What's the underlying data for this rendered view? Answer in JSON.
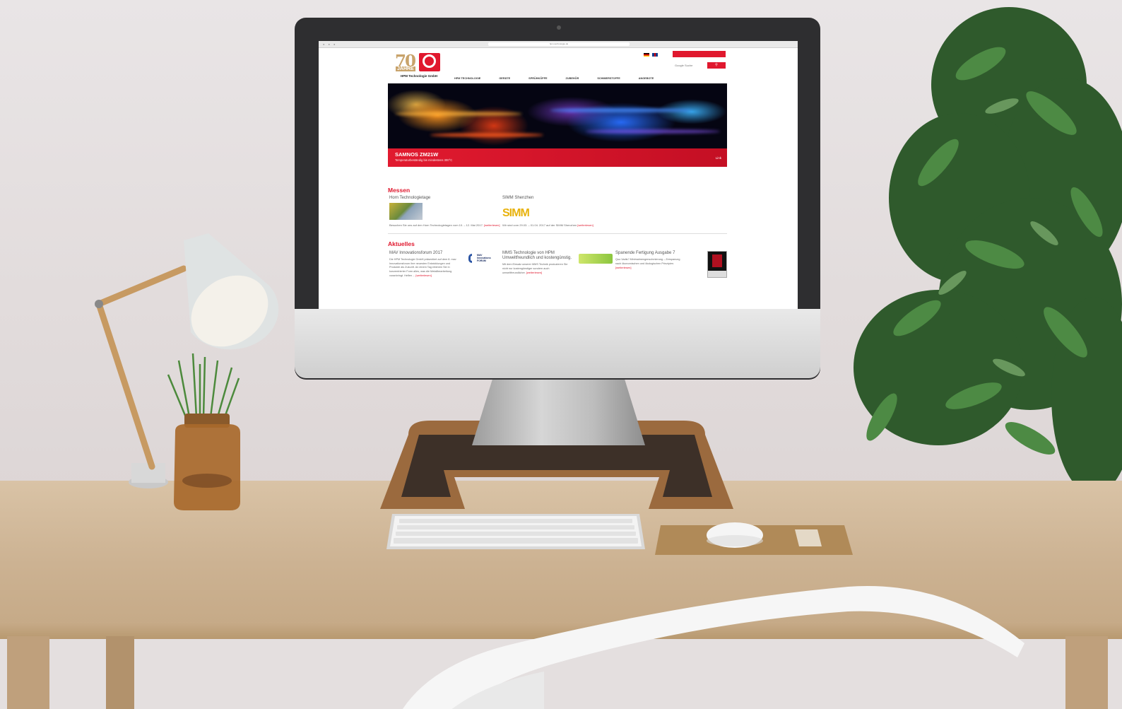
{
  "browser": {
    "url": "hpm-technologie.de"
  },
  "site": {
    "logo": {
      "number": "70",
      "jahre": "JAHRE",
      "company": "HPM Technologie GmbH"
    },
    "search": {
      "placeholder": "Google Suche",
      "button_icon": "search-icon"
    },
    "nav": [
      "HPM TECHNOLOGIE",
      "GERÄTE",
      "SPRÜHKÖPFE",
      "ZUBEHÖR",
      "SCHMIERSTOFFE",
      "ANGEBOTE"
    ],
    "hero": {
      "title": "SAMNOS ZM21W",
      "subtitle": "Temperaturbeständig bis mindestens 300°C",
      "link": "Link"
    },
    "messen": {
      "heading": "Messen",
      "items": [
        {
          "title": "Horn Technologietage",
          "text": "Besuchen Sie uns auf den Horn Technologietagen vom 10. – 12. Mai 2017.",
          "more": "[weiterlesen]"
        },
        {
          "title": "SIMM Shenzhen",
          "thumb_label": "SIMM",
          "text": "Wir sind vom 29.03. – 01.04. 2017 auf der SIMM Shenzhen",
          "more": "[weiterlesen]"
        }
      ]
    },
    "aktuelles": {
      "heading": "Aktuelles",
      "items": [
        {
          "title": "MAV Innovationsforum 2017",
          "thumb_label": "MAV Innovations FORUM",
          "text": "Die HPM Technologie GmbH präsentiert auf dem 8. mav Innovationsforum ihre neuesten Entwicklungen und Produkte als Zukunft. An einem Tag erfahren Sie in konzentrierter Form alles, was die Metallbearbeitung voranbringt. Helfen ...",
          "more": "[weiterlesen]"
        },
        {
          "title": "MMS Technologie von HPM Umweltfreundlich und kostengünstig.",
          "text": "Mit dem Einsatz unserer MMS Technik produzieren Sie nicht nur kostengünstiger sondern auch umweltfreundlicher.",
          "more": "[weiterlesen]"
        },
        {
          "title": "Spanende Fertigung Ausgabe 7",
          "text": "Quo Vadis? Minimalmengenschmierung – Zerspanung nach ökonomischen und ökologischen Prinzipien.",
          "more": "[weiterlesen]"
        }
      ]
    }
  },
  "colors": {
    "brand_red": "#e0182e",
    "logo_gold": "#c8a36b"
  }
}
